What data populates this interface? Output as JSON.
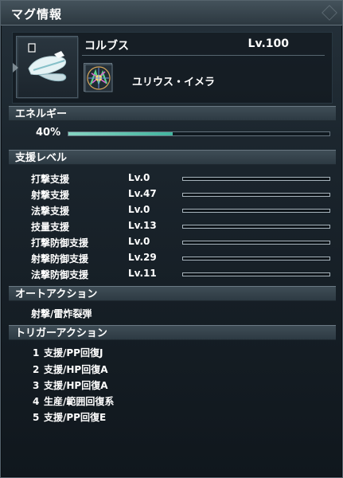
{
  "window": {
    "title": "マグ情報"
  },
  "mag": {
    "name": "コルブス",
    "level": "Lv.100",
    "photon_blast": "ユリウス・イメラ"
  },
  "sections": {
    "energy": "エネルギー",
    "support_level": "支援レベル",
    "auto_action": "オートアクション",
    "trigger_action": "トリガーアクション"
  },
  "energy": {
    "label": "40%",
    "value_percent": 40
  },
  "support": [
    {
      "label": "打撃支援",
      "level": "Lv.0",
      "fill": 0.0
    },
    {
      "label": "射撃支援",
      "level": "Lv.47",
      "fill": 0.0
    },
    {
      "label": "法撃支援",
      "level": "Lv.0",
      "fill": 0.0
    },
    {
      "label": "技量支援",
      "level": "Lv.13",
      "fill": 0.0
    },
    {
      "label": "打撃防御支援",
      "level": "Lv.0",
      "fill": 0.0
    },
    {
      "label": "射撃防御支援",
      "level": "Lv.29",
      "fill": 0.0
    },
    {
      "label": "法撃防御支援",
      "level": "Lv.11",
      "fill": 0.0
    }
  ],
  "auto_action": {
    "value": "射撃/雷炸裂弾"
  },
  "triggers": [
    {
      "num": "1",
      "text": "支援/PP回復J"
    },
    {
      "num": "2",
      "text": "支援/HP回復A"
    },
    {
      "num": "3",
      "text": "支援/HP回復A"
    },
    {
      "num": "4",
      "text": "生産/範囲回復系"
    },
    {
      "num": "5",
      "text": "支援/PP回復E"
    }
  ],
  "icons": {
    "mag_image": "mag-image",
    "photon_blast_icon": "photon-blast-icon"
  }
}
